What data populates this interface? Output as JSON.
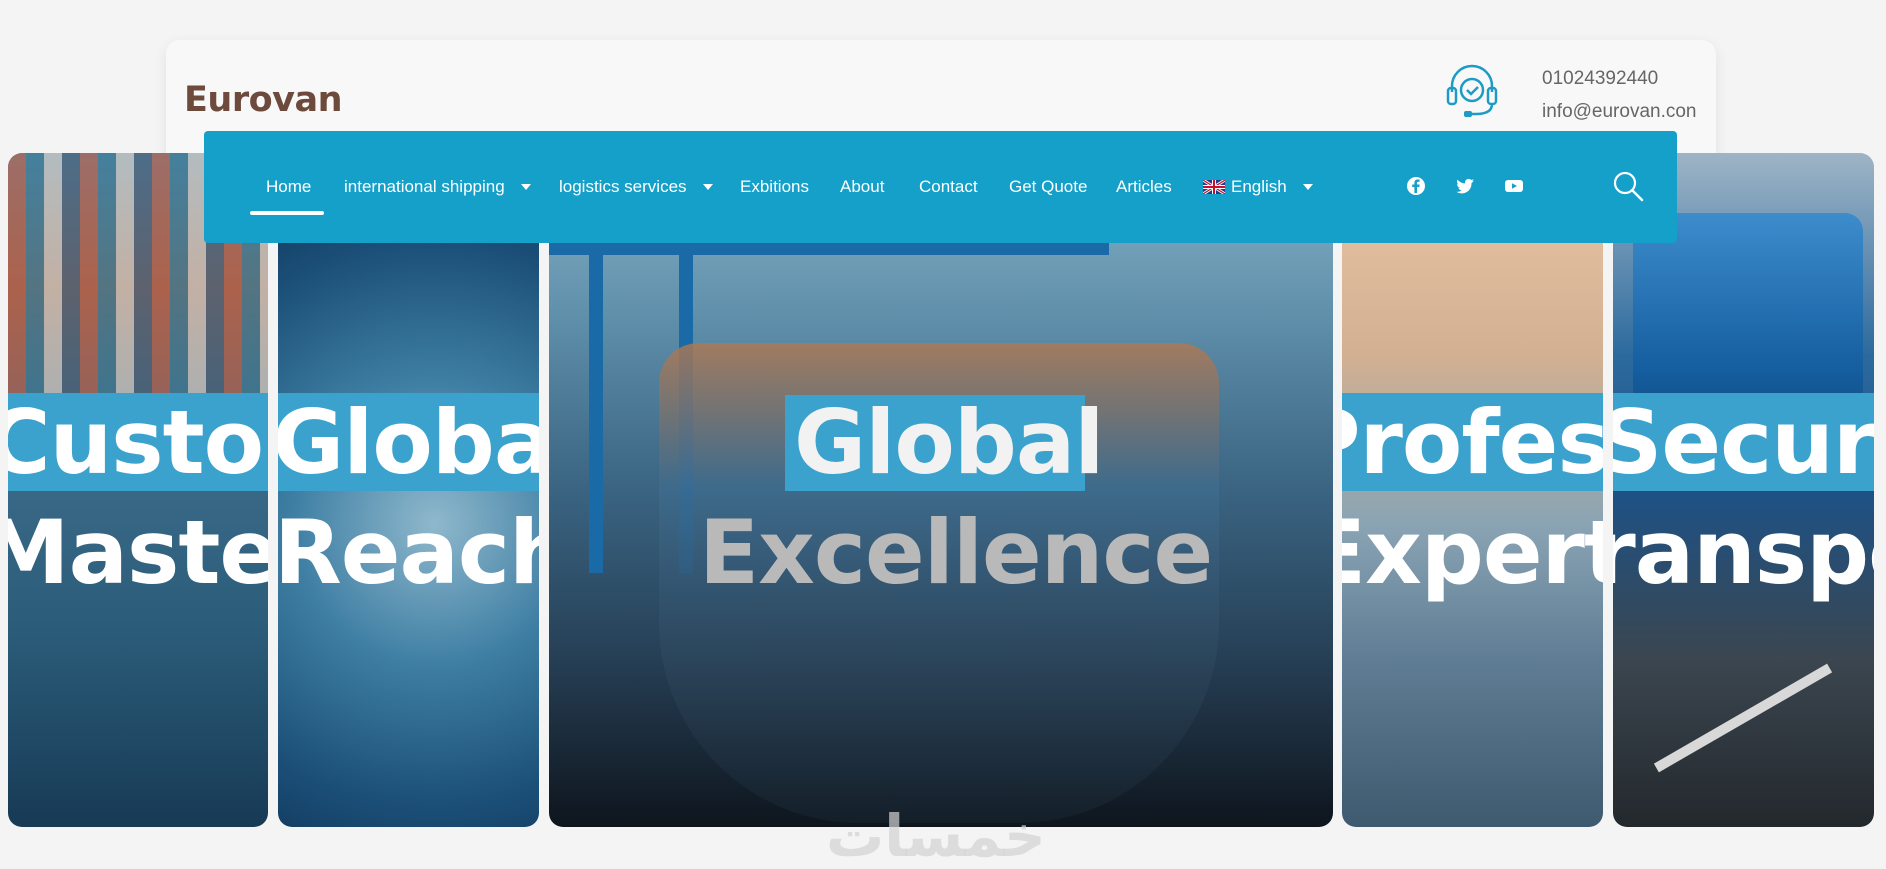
{
  "header": {
    "logo": "Eurovan",
    "phone": "01024392440",
    "email": "info@eurovan.con",
    "support_icon": "headset-check-icon"
  },
  "nav": {
    "items": [
      {
        "label": "Home",
        "active": true
      },
      {
        "label": "international shipping",
        "dropdown": true
      },
      {
        "label": "logistics services",
        "dropdown": true
      },
      {
        "label": "Exbitions"
      },
      {
        "label": "About"
      },
      {
        "label": "Contact"
      },
      {
        "label": "Get Quote"
      },
      {
        "label": "Articles"
      },
      {
        "label": "English",
        "dropdown": true,
        "icon": "uk-flag-icon"
      }
    ],
    "social": [
      "facebook-icon",
      "twitter-icon",
      "youtube-icon"
    ],
    "search_icon": "search-icon",
    "color": "#14a0c9"
  },
  "panels": [
    {
      "line1": "Custom",
      "line2": "Master"
    },
    {
      "line1": "Global",
      "line2": "Reach"
    },
    {
      "line1": "Global",
      "line2": "Excellence"
    },
    {
      "line1": "Professio",
      "line2": "Expertis"
    },
    {
      "line1": "Secure",
      "line2": "Transpo"
    }
  ],
  "watermark": "خمسات"
}
